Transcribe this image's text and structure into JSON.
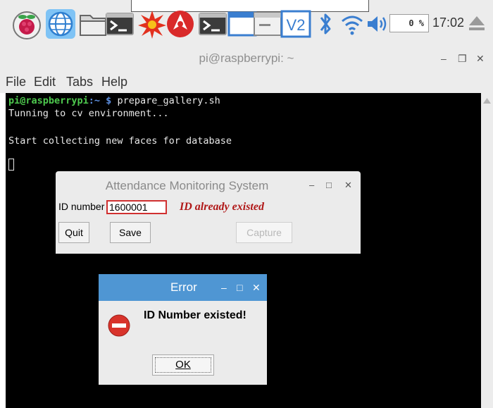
{
  "panel": {
    "cpu_usage": "0 %",
    "clock": "17:02"
  },
  "terminal": {
    "title": "pi@raspberrypi: ~",
    "menu": [
      "File",
      "Edit",
      "Tabs",
      "Help"
    ],
    "prompt_user": "pi@raspberrypi",
    "prompt_path": ":~ $",
    "command": " prepare_gallery.sh",
    "lines": [
      "Tunning to cv environment...",
      "",
      "Start collecting new faces for database"
    ]
  },
  "attendance": {
    "title": "Attendance Monitoring System",
    "id_label": "ID number",
    "id_value": "1600001",
    "message": "ID already existed",
    "quit_label": "Quit",
    "save_label": "Save",
    "capture_label": "Capture"
  },
  "error": {
    "title": "Error",
    "message": "ID Number existed!",
    "ok_label": "OK"
  },
  "colors": {
    "terminal_bg": "#000000",
    "prompt_green": "#4ec94e",
    "prompt_blue": "#5d8fe0",
    "error_title_bg": "#4f96d3",
    "error_text": "#b01818"
  }
}
